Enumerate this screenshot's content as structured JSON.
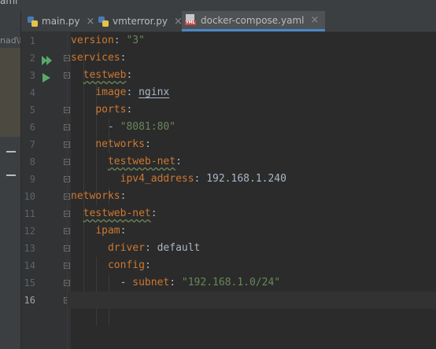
{
  "window": {
    "title_fragment": "aml"
  },
  "project_panel": {
    "path_fragment": "nad\\I"
  },
  "tabs": [
    {
      "label": "main.py",
      "icon": "python-file-icon"
    },
    {
      "label": "vmterror.py",
      "icon": "python-file-icon"
    },
    {
      "label": "docker-compose.yaml",
      "icon": "yaml-file-icon",
      "active": true
    }
  ],
  "close_glyph": "×",
  "yaml_badge": "YML",
  "editor": {
    "current_line": 16,
    "lines": [
      {
        "n": "1",
        "k": "version",
        "sep": ": ",
        "v": "\"3\"",
        "vt": "str"
      },
      {
        "n": "2",
        "k": "services",
        "sep": ":"
      },
      {
        "n": "3",
        "indent": "  ",
        "k": "testweb",
        "sep": ":"
      },
      {
        "n": "4",
        "indent": "    ",
        "k": "image",
        "sep": ": ",
        "v": "nginx",
        "vt": "val"
      },
      {
        "n": "5",
        "indent": "    ",
        "k": "ports",
        "sep": ":"
      },
      {
        "n": "6",
        "indent": "      ",
        "dash": "- ",
        "v": "\"8081:80\"",
        "vt": "str"
      },
      {
        "n": "7",
        "indent": "    ",
        "k": "networks",
        "sep": ":"
      },
      {
        "n": "8",
        "indent": "      ",
        "k": "testweb-net",
        "sep": ":"
      },
      {
        "n": "9",
        "indent": "        ",
        "k": "ipv4_address",
        "sep": ": ",
        "v": "192.168.1.240",
        "vt": "val"
      },
      {
        "n": "10",
        "k": "networks",
        "sep": ":"
      },
      {
        "n": "11",
        "indent": "  ",
        "k": "testweb-net",
        "sep": ":"
      },
      {
        "n": "12",
        "indent": "    ",
        "k": "ipam",
        "sep": ":"
      },
      {
        "n": "13",
        "indent": "      ",
        "k": "driver",
        "sep": ": ",
        "v": "default",
        "vt": "val"
      },
      {
        "n": "14",
        "indent": "      ",
        "k": "config",
        "sep": ":"
      },
      {
        "n": "15",
        "indent": "        ",
        "dash": "- ",
        "k": "subnet",
        "sep": ": ",
        "v": "\"192.168.1.0/24\"",
        "vt": "str"
      },
      {
        "n": "16"
      }
    ]
  },
  "colors": {
    "background": "#2b2b2b",
    "gutter": "#313335",
    "key": "#cc7832",
    "string": "#6a8759",
    "text": "#a9b7c6",
    "line_number": "#606366",
    "run_icon": "#59a869",
    "active_tab_underline": "#4a88c7"
  }
}
